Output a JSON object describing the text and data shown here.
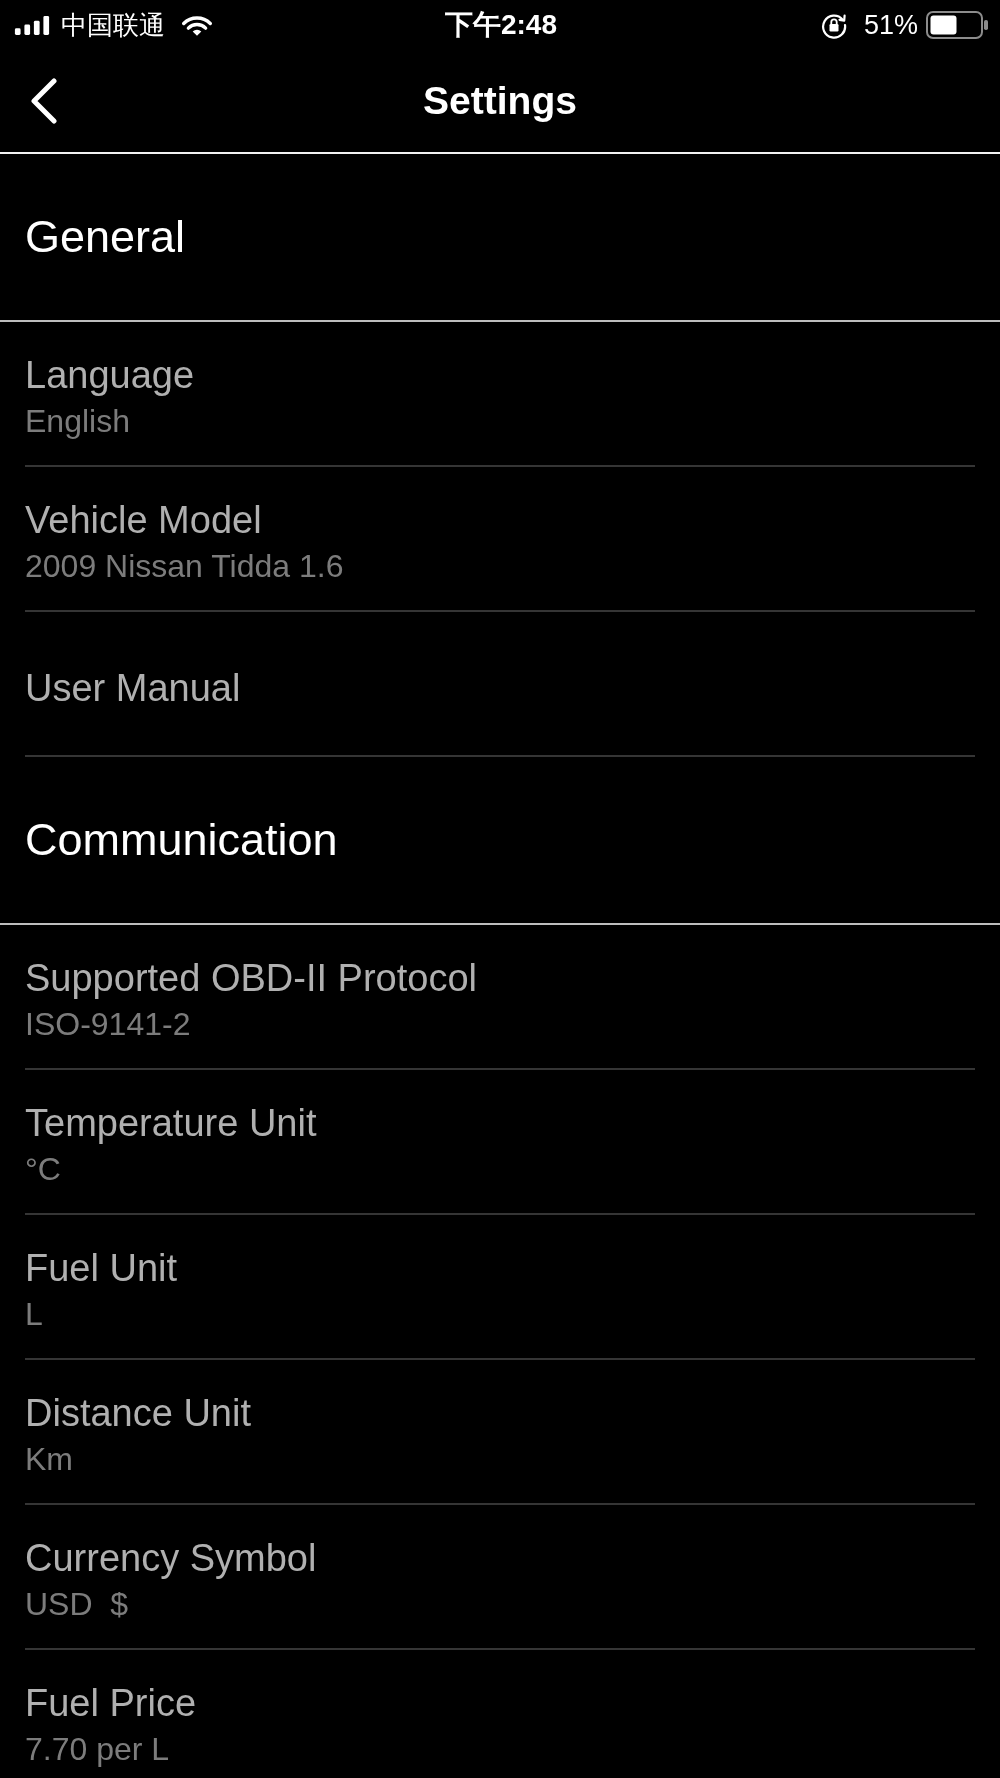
{
  "status_bar": {
    "carrier": "中国联通",
    "time": "下午2:48",
    "battery_percent": "51%"
  },
  "nav_bar": {
    "title": "Settings"
  },
  "sections": [
    {
      "title": "General",
      "items": [
        {
          "label": "Language",
          "value": "English"
        },
        {
          "label": "Vehicle Model",
          "value": "2009 Nissan Tidda 1.6"
        },
        {
          "label": "User Manual"
        }
      ]
    },
    {
      "title": "Communication",
      "items": [
        {
          "label": "Supported OBD-II Protocol",
          "value": "ISO-9141-2"
        },
        {
          "label": "Temperature Unit",
          "value": "°C"
        },
        {
          "label": "Fuel Unit",
          "value": "L"
        },
        {
          "label": "Distance Unit",
          "value": "Km"
        },
        {
          "label": "Currency Symbol",
          "value": "USD  $"
        },
        {
          "label": "Fuel Price",
          "value": "7.70 per L"
        }
      ]
    }
  ]
}
